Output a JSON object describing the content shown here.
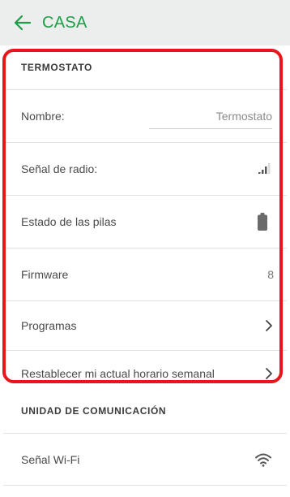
{
  "header": {
    "title": "CASA",
    "accent_color": "#1e9e48",
    "back_icon": "arrow-left-icon"
  },
  "thermostat_section": {
    "title": "TERMOSTATO",
    "name_label": "Nombre:",
    "name_value": "Termostato",
    "radio_signal_label": "Señal de radio:",
    "radio_signal_icon": "signal-bars-icon",
    "battery_label": "Estado de las pilas",
    "battery_icon": "battery-icon",
    "firmware_label": "Firmware",
    "firmware_value": "8",
    "programs_label": "Programas",
    "reset_schedule_label": "Restablecer mi actual horario semanal"
  },
  "communication_section": {
    "title": "UNIDAD DE COMUNICACIÓN",
    "wifi_label": "Señal Wi-Fi",
    "wifi_icon": "wifi-icon"
  },
  "highlight_color": "#e8151b"
}
